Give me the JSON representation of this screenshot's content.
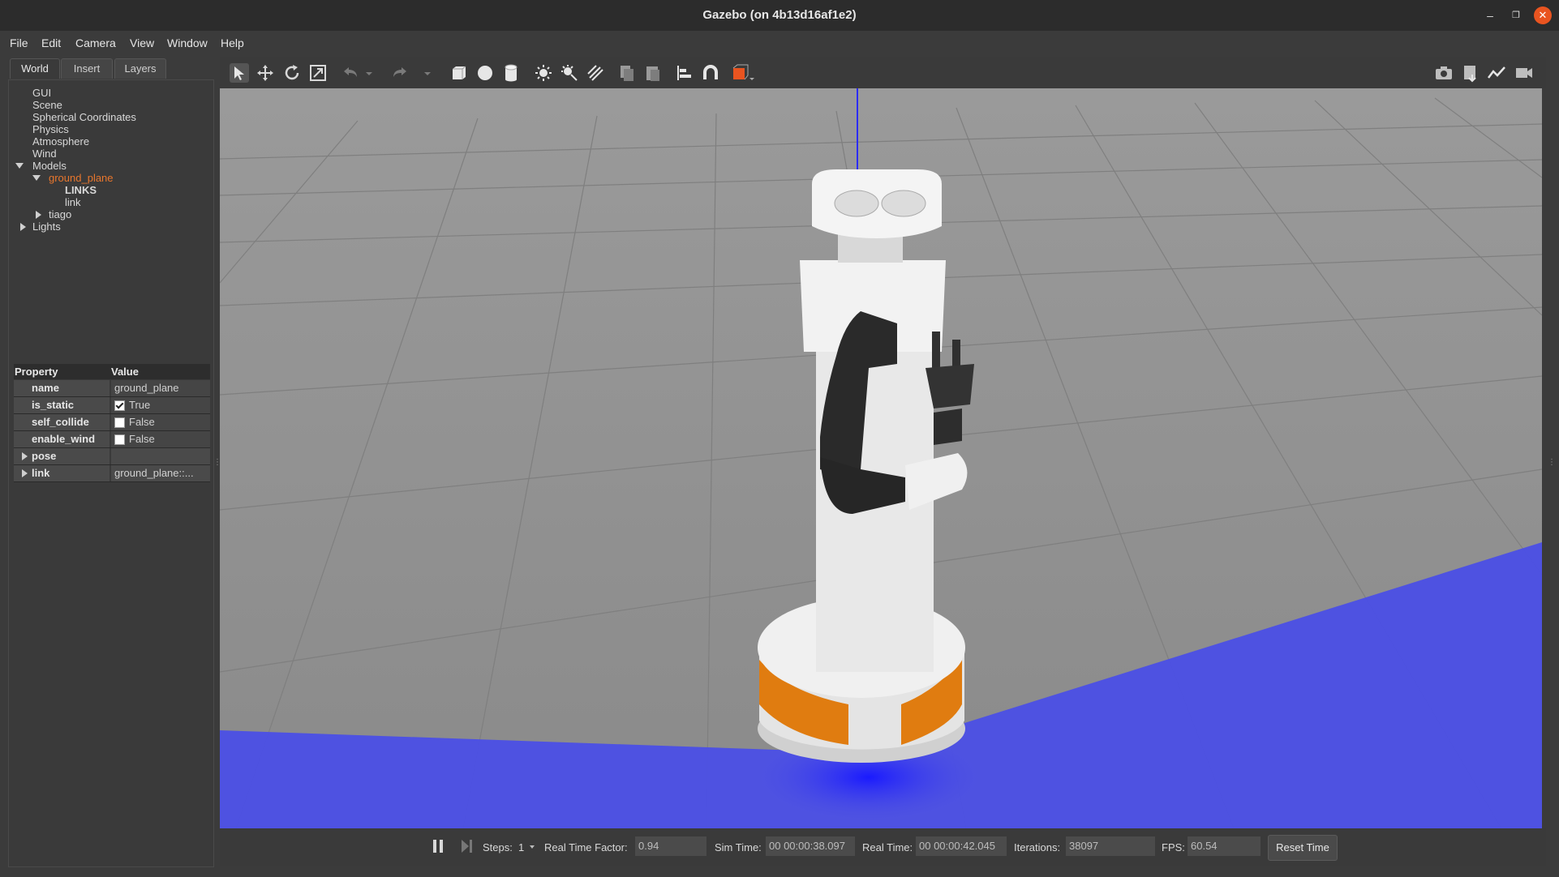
{
  "window": {
    "title": "Gazebo (on 4b13d16af1e2)"
  },
  "menu": [
    "File",
    "Edit",
    "Camera",
    "View",
    "Window",
    "Help"
  ],
  "tabs": [
    "World",
    "Insert",
    "Layers"
  ],
  "tree": {
    "items": [
      "GUI",
      "Scene",
      "Spherical Coordinates",
      "Physics",
      "Atmosphere",
      "Wind",
      "Models",
      "ground_plane",
      "LINKS",
      "link",
      "tiago",
      "Lights"
    ],
    "selected": "ground_plane"
  },
  "properties": {
    "header": {
      "key": "Property",
      "value": "Value"
    },
    "rows": [
      {
        "key": "name",
        "value": "ground_plane"
      },
      {
        "key": "is_static",
        "value": "True",
        "checked": true
      },
      {
        "key": "self_collide",
        "value": "False",
        "checked": false
      },
      {
        "key": "enable_wind",
        "value": "False",
        "checked": false
      },
      {
        "key": "pose",
        "value": ""
      },
      {
        "key": "link",
        "value": "ground_plane::..."
      }
    ]
  },
  "toolbar": {
    "icons": [
      "select-arrow-icon",
      "translate-icon",
      "rotate-icon",
      "scale-icon",
      "undo-icon",
      "undo-dropdown-icon",
      "redo-icon",
      "redo-dropdown-icon",
      "box-icon",
      "sphere-icon",
      "cylinder-icon",
      "point-light-icon",
      "spot-light-icon",
      "directional-light-icon",
      "copy-icon",
      "paste-icon",
      "align-icon",
      "snap-icon",
      "view-angle-icon"
    ],
    "right_icons": [
      "screenshot-icon",
      "log-icon",
      "plot-icon",
      "record-video-icon"
    ]
  },
  "bottombar": {
    "steps_label": "Steps:",
    "steps_value": "1",
    "rtf_label": "Real Time Factor:",
    "rtf_value": "0.94",
    "sim_label": "Sim Time:",
    "sim_value": "00 00:00:38.097",
    "real_label": "Real Time:",
    "real_value": "00 00:00:42.045",
    "iter_label": "Iterations:",
    "iter_value": "38097",
    "fps_label": "FPS:",
    "fps_value": "60.54",
    "reset_label": "Reset Time"
  },
  "colors": {
    "selected": "#e8762d",
    "laser": "#4b4fe6",
    "ground": "#8f8f8f"
  }
}
